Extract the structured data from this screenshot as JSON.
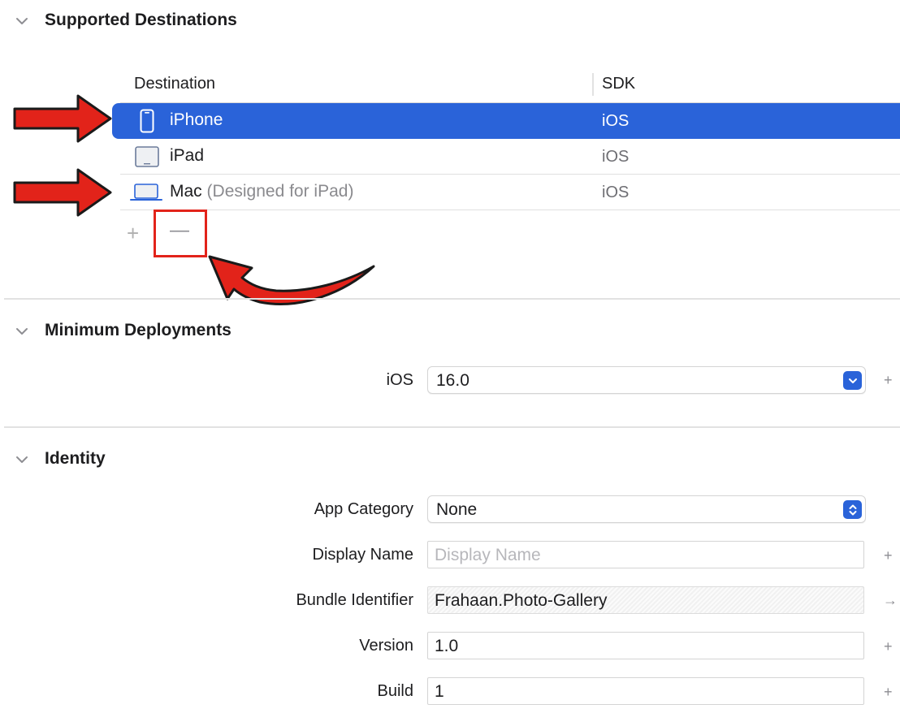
{
  "sections": {
    "supported_destinations": {
      "title": "Supported Destinations"
    },
    "minimum_deployments": {
      "title": "Minimum Deployments"
    },
    "identity": {
      "title": "Identity"
    }
  },
  "destinations": {
    "columns": {
      "destination": "Destination",
      "sdk": "SDK"
    },
    "rows": [
      {
        "name": "iPhone",
        "suffix": "",
        "sdk": "iOS",
        "icon": "iphone-icon",
        "selected": true
      },
      {
        "name": "iPad",
        "suffix": "",
        "sdk": "iOS",
        "icon": "ipad-icon",
        "selected": false
      },
      {
        "name": "Mac",
        "suffix": "(Designed for iPad)",
        "sdk": "iOS",
        "icon": "macbook-icon",
        "selected": false
      }
    ],
    "add_label": "+",
    "remove_label": "—"
  },
  "deployments": {
    "ios_label": "iOS",
    "ios_value": "16.0",
    "add_label": "+"
  },
  "identity": {
    "app_category": {
      "label": "App Category",
      "value": "None"
    },
    "display_name": {
      "label": "Display Name",
      "value": "",
      "placeholder": "Display Name",
      "side": "+"
    },
    "bundle_identifier": {
      "label": "Bundle Identifier",
      "value": "Frahaan.Photo-Gallery",
      "side": "→"
    },
    "version": {
      "label": "Version",
      "value": "1.0",
      "side": "+"
    },
    "build": {
      "label": "Build",
      "value": "1",
      "side": "+"
    }
  },
  "colors": {
    "selection": "#2a63d9",
    "annotation_red": "#e2231a",
    "icon_blue": "#2a63d9"
  }
}
